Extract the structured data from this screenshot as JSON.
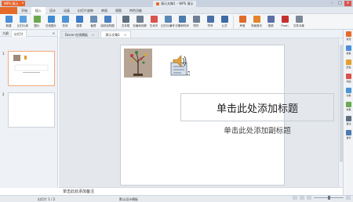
{
  "title_bar": {
    "app_name": "WPS 演示",
    "doc_tab": "演示文稿1",
    "doc_tab_suffix": " - WPS 演示"
  },
  "menu": [
    "开始",
    "插入",
    "设计",
    "动画",
    "幻灯片放映",
    "审阅",
    "视图",
    "特色功能"
  ],
  "ribbon": [
    {
      "label": "新建",
      "icon": "new-slide-icon",
      "color": "#4a8fd8"
    },
    {
      "label": "幻灯片库",
      "icon": "slide-library-icon",
      "color": "#5aa0e0"
    },
    {
      "label": "图片",
      "icon": "picture-icon",
      "color": "#6aaa4f"
    },
    {
      "label": "在线图片",
      "icon": "online-picture-icon",
      "color": "#3d8bd0"
    },
    {
      "label": "形状",
      "icon": "shapes-icon",
      "color": "#4d94d6"
    },
    {
      "label": "图表",
      "icon": "chart-icon",
      "color": "#3b7bc8"
    },
    {
      "label": "截屏",
      "icon": "screenshot-icon",
      "color": "#6b8db3"
    },
    {
      "label": "组织结构图",
      "icon": "org-chart-icon",
      "color": "#4a7fc2"
    },
    {
      "label": "文本框",
      "icon": "textbox-icon",
      "color": "#5f6f80"
    },
    {
      "label": "页眉和页脚",
      "icon": "header-footer-icon",
      "color": "#6c7d90"
    },
    {
      "label": "艺术字",
      "icon": "wordart-icon",
      "color": "#d9534f"
    },
    {
      "label": "幻灯片编号",
      "icon": "slide-number-icon",
      "color": "#5b86b8"
    },
    {
      "label": "日期和时间",
      "icon": "date-time-icon",
      "color": "#4d7bb0"
    },
    {
      "label": "附件",
      "icon": "attachment-icon",
      "color": "#6f8094"
    },
    {
      "label": "符号",
      "icon": "symbol-icon",
      "color": "#4b6fa8"
    },
    {
      "label": "公式",
      "icon": "formula-icon",
      "color": "#3e6aa6"
    },
    {
      "label": "声音",
      "icon": "sound-icon",
      "color": "#e06b2c"
    },
    {
      "label": "背景音乐",
      "icon": "bg-music-icon",
      "color": "#e2852c"
    },
    {
      "label": "视频",
      "icon": "video-icon",
      "color": "#5a6ea8"
    },
    {
      "label": "Flash",
      "icon": "flash-icon",
      "color": "#c62f2f"
    },
    {
      "label": "文件对象",
      "icon": "file-object-icon",
      "color": "#7a8899"
    }
  ],
  "right_panel": [
    {
      "label": "新建",
      "icon": "new-icon",
      "color": "#e56b2b"
    },
    {
      "label": "模板",
      "icon": "template-icon",
      "color": "#4a8fd8"
    },
    {
      "label": "配色",
      "icon": "color-scheme-icon",
      "color": "#e0a02c"
    },
    {
      "label": "动画",
      "icon": "animation-icon",
      "color": "#d9534f"
    },
    {
      "label": "切换",
      "icon": "transition-icon",
      "color": "#4d94d6"
    },
    {
      "label": "效果",
      "icon": "effect-icon",
      "color": "#6aaa4f"
    },
    {
      "label": "备注",
      "icon": "notes-icon",
      "color": "#5f6f80"
    },
    {
      "label": "备份",
      "icon": "backup-icon",
      "color": "#4d7bb0"
    }
  ],
  "left_panel": {
    "tab_outline": "大纲",
    "tab_slides": "幻灯片",
    "close": "×",
    "slide_numbers": [
      "1",
      "2"
    ]
  },
  "doc_tabs": [
    {
      "label": "Docer-在线模板",
      "active": false
    },
    {
      "label": "演示文稿1",
      "active": true
    }
  ],
  "slide": {
    "title_placeholder": "单击此处添加标题",
    "subtitle_placeholder": "单击此处添加副标题"
  },
  "notes_placeholder": "单击此处添加备注",
  "status": {
    "slide_info": "幻灯片 1 / 2",
    "template": "默认设计模板"
  }
}
